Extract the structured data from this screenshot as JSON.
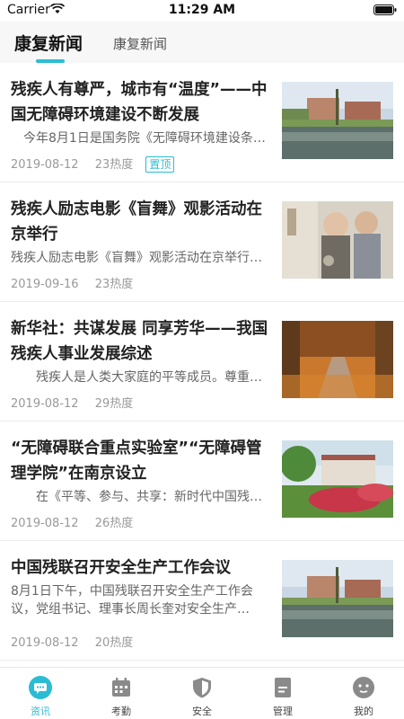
{
  "status": {
    "carrier": "Carrier",
    "time": "11:29 AM"
  },
  "tabs": [
    {
      "label": "康复新闻"
    },
    {
      "label": "康复新闻"
    }
  ],
  "articles": [
    {
      "title": "残疾人有尊严，城市有“温度”——中国无障碍环境建设不断发展",
      "summary": "　今年8月1日是国务院《无障碍环境建设条例》…",
      "date": "2019-08-12",
      "heat": "23热度",
      "badge": "置顶"
    },
    {
      "title": "残疾人励志电影《盲舞》观影活动在京举行",
      "summary": "残疾人励志电影《盲舞》观影活动在京举行…",
      "date": "2019-09-16",
      "heat": "23热度"
    },
    {
      "title": "新华社：共谋发展 同享芳华——我国残疾人事业发展综述",
      "summary": "　　残疾人是人类大家庭的平等成员。尊重…",
      "date": "2019-08-12",
      "heat": "29热度"
    },
    {
      "title": "“无障碍联合重点实验室”“无障碍管理学院”在南京设立",
      "summary": "　　在《平等、参与、共享：新时代中国残疾…",
      "date": "2019-08-12",
      "heat": "26热度"
    },
    {
      "title": "中国残联召开安全生产工作会议",
      "summary": "8月1日下午，中国残联召开安全生产工作会议，党组书记、理事长周长奎对安全生产…",
      "date": "2019-08-12",
      "heat": "20热度"
    }
  ],
  "tabbar": [
    {
      "label": "资讯",
      "icon": "news-chat-icon",
      "active": true
    },
    {
      "label": "考勤",
      "icon": "calendar-icon"
    },
    {
      "label": "安全",
      "icon": "shield-icon"
    },
    {
      "label": "管理",
      "icon": "document-icon"
    },
    {
      "label": "我的",
      "icon": "profile-face-icon"
    }
  ],
  "colors": {
    "accent": "#2bbcd4",
    "tab_bg": "#f7f7f7",
    "icon_gray": "#8a8a8a"
  }
}
